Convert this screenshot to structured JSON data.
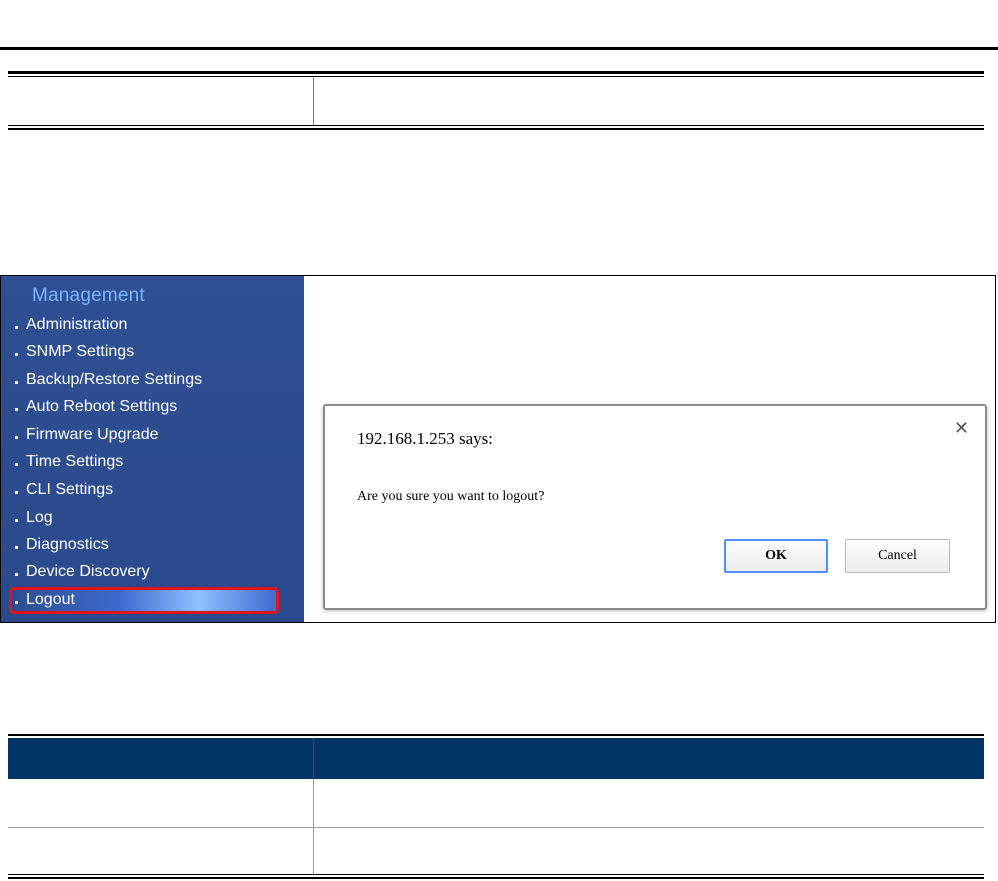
{
  "sidebar": {
    "section_title": "Management",
    "items": [
      {
        "label": "Administration"
      },
      {
        "label": "SNMP Settings"
      },
      {
        "label": "Backup/Restore Settings"
      },
      {
        "label": "Auto Reboot Settings"
      },
      {
        "label": "Firmware Upgrade"
      },
      {
        "label": "Time Settings"
      },
      {
        "label": "CLI Settings"
      },
      {
        "label": "Log"
      },
      {
        "label": "Diagnostics"
      },
      {
        "label": "Device Discovery"
      },
      {
        "label": "Logout"
      }
    ],
    "active_item": "Logout",
    "highlight_color": "#e0141b"
  },
  "dialog": {
    "title": "192.168.1.253 says:",
    "message": "Are you sure you want to logout?",
    "ok_label": "OK",
    "cancel_label": "Cancel",
    "close_icon": "close-icon"
  },
  "colors": {
    "sidebar_bg": "#2f4f93",
    "table_header_bg": "#003366",
    "focus_border": "#4d90fe"
  }
}
